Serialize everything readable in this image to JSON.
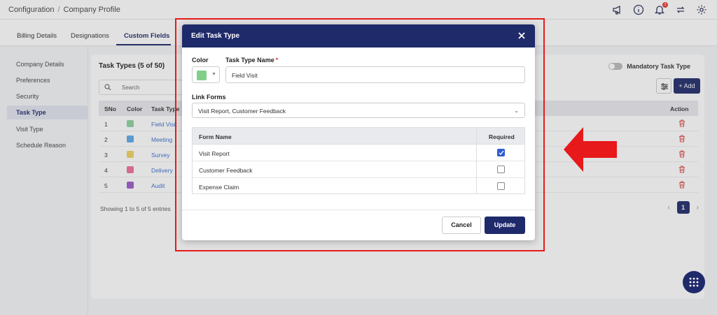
{
  "topbar": {
    "breadcrumb": [
      "Configuration",
      "Company Profile"
    ],
    "separator": "/",
    "icons": [
      "megaphone-icon",
      "info-icon",
      "bell-icon",
      "sync-icon",
      "gear-icon"
    ],
    "notification_count": "3"
  },
  "tabs": [
    {
      "label": "Billing Details",
      "active": false
    },
    {
      "label": "Designations",
      "active": false
    },
    {
      "label": "Custom Fields",
      "active": true
    }
  ],
  "sidebar": {
    "items": [
      {
        "label": "Company Details",
        "active": false
      },
      {
        "label": "Preferences",
        "active": false
      },
      {
        "label": "Security",
        "active": false
      },
      {
        "label": "Task Type",
        "active": true
      },
      {
        "label": "Visit Type",
        "active": false
      },
      {
        "label": "Schedule Reason",
        "active": false
      }
    ]
  },
  "main": {
    "title": "Task Types (5 of 50)",
    "mandatory_toggle_label": "Mandatory Task Type",
    "search_placeholder": "Search",
    "add_label": "+ Add",
    "table": {
      "columns": [
        "SNo",
        "Color",
        "Task Type",
        "Action"
      ],
      "rows": [
        {
          "sno": "1",
          "color": "#8fd19e",
          "name": "Field Visit"
        },
        {
          "sno": "2",
          "color": "#5ca9e8",
          "name": "Meeting"
        },
        {
          "sno": "3",
          "color": "#f2d060",
          "name": "Survey"
        },
        {
          "sno": "4",
          "color": "#ef6f9a",
          "name": "Delivery"
        },
        {
          "sno": "5",
          "color": "#9b59c9",
          "name": "Audit"
        }
      ]
    },
    "showing": "Showing 1 to 5 of 5 entries",
    "pagination": {
      "current_page": "1",
      "prev": "‹",
      "next": "›"
    }
  },
  "modal": {
    "title": "Edit Task Type",
    "color_label": "Color",
    "selected_color": "#7fcf8a",
    "task_type_name_label": "Task Type Name",
    "required_marker": "*",
    "task_type_name_value": "Field Visit",
    "link_forms_label": "Link Forms",
    "link_forms_value": "Visit Report, Customer Feedback",
    "forms_table": {
      "columns": [
        "Form Name",
        "Required"
      ],
      "rows": [
        {
          "name": "Visit Report",
          "required": true
        },
        {
          "name": "Customer Feedback",
          "required": false
        },
        {
          "name": "Expense Claim",
          "required": false
        }
      ]
    },
    "cancel_label": "Cancel",
    "update_label": "Update"
  },
  "colors": {
    "brand_navy": "#1f2a6b",
    "annotation_red": "#e8191b",
    "check_blue": "#2f5bd2"
  }
}
